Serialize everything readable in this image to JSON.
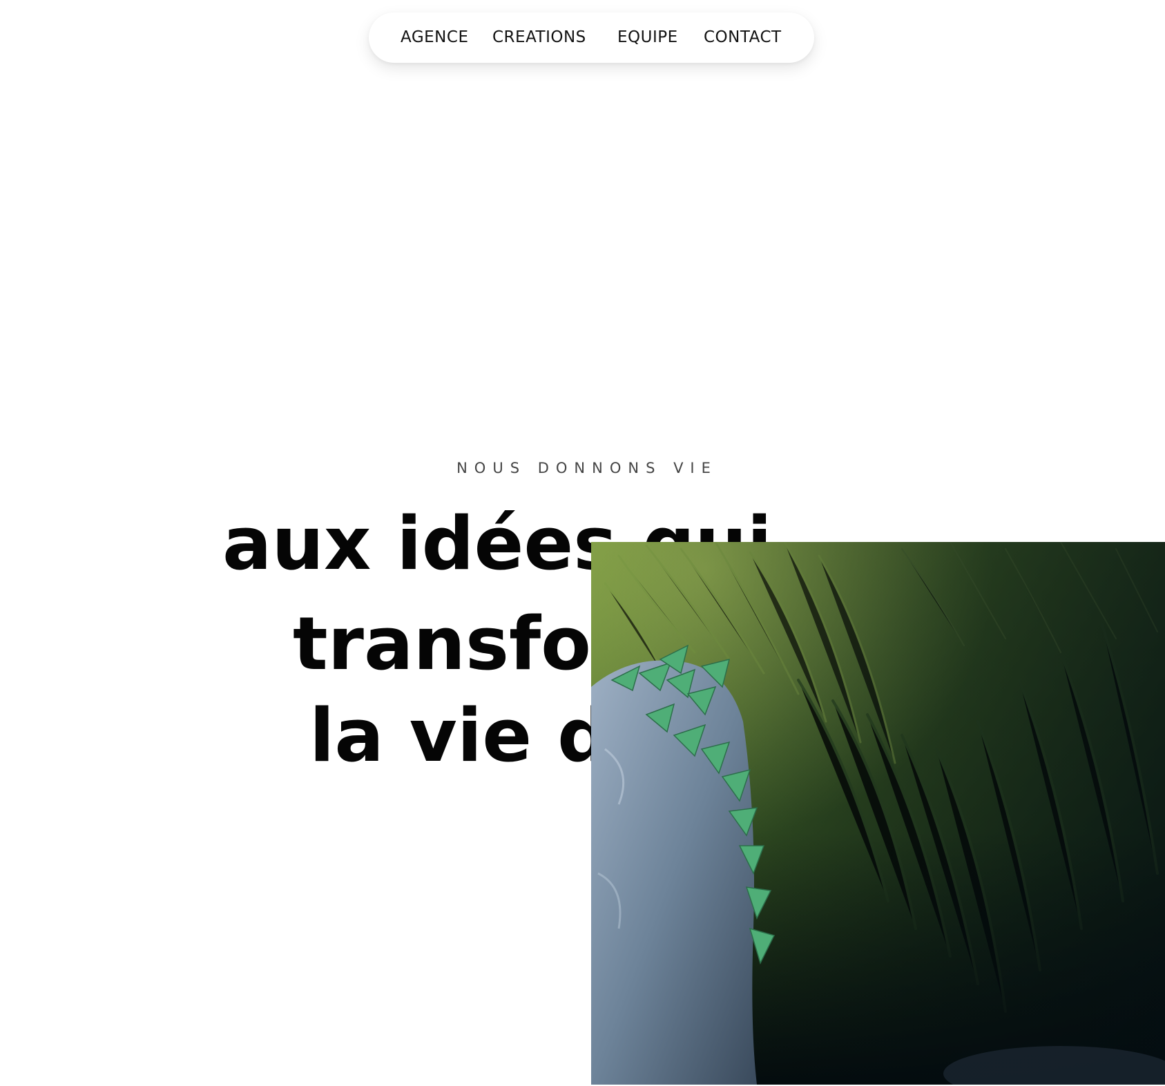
{
  "nav": {
    "items": [
      "AGENCE",
      "CREATIONS",
      "EQUIPE",
      "CONTACT"
    ]
  },
  "hero": {
    "eyebrow": "NOUS DONNONS VIE",
    "lines": [
      "aux idées qui",
      "transfor",
      "la vie de"
    ]
  },
  "media": {
    "icon": "video-thumbnail-grass-rock"
  }
}
